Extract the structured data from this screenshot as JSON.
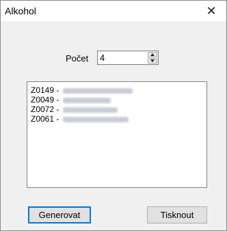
{
  "window": {
    "title": "Alkohol",
    "close_glyph": "✕"
  },
  "form": {
    "count_label": "Počet",
    "count_value": "4"
  },
  "list": {
    "items": [
      {
        "code": "Z0149 -"
      },
      {
        "code": "Z0049 -"
      },
      {
        "code": "Z0072 -"
      },
      {
        "code": "Z0061 -"
      }
    ]
  },
  "buttons": {
    "generate_label": "Generovat",
    "print_label": "Tisknout"
  },
  "icons": {
    "close": "close-icon",
    "spin_up": "arrow-up-icon",
    "spin_down": "arrow-down-icon"
  },
  "colors": {
    "focus_border": "#0078d7",
    "dialog_bg": "#f0f0f0"
  }
}
